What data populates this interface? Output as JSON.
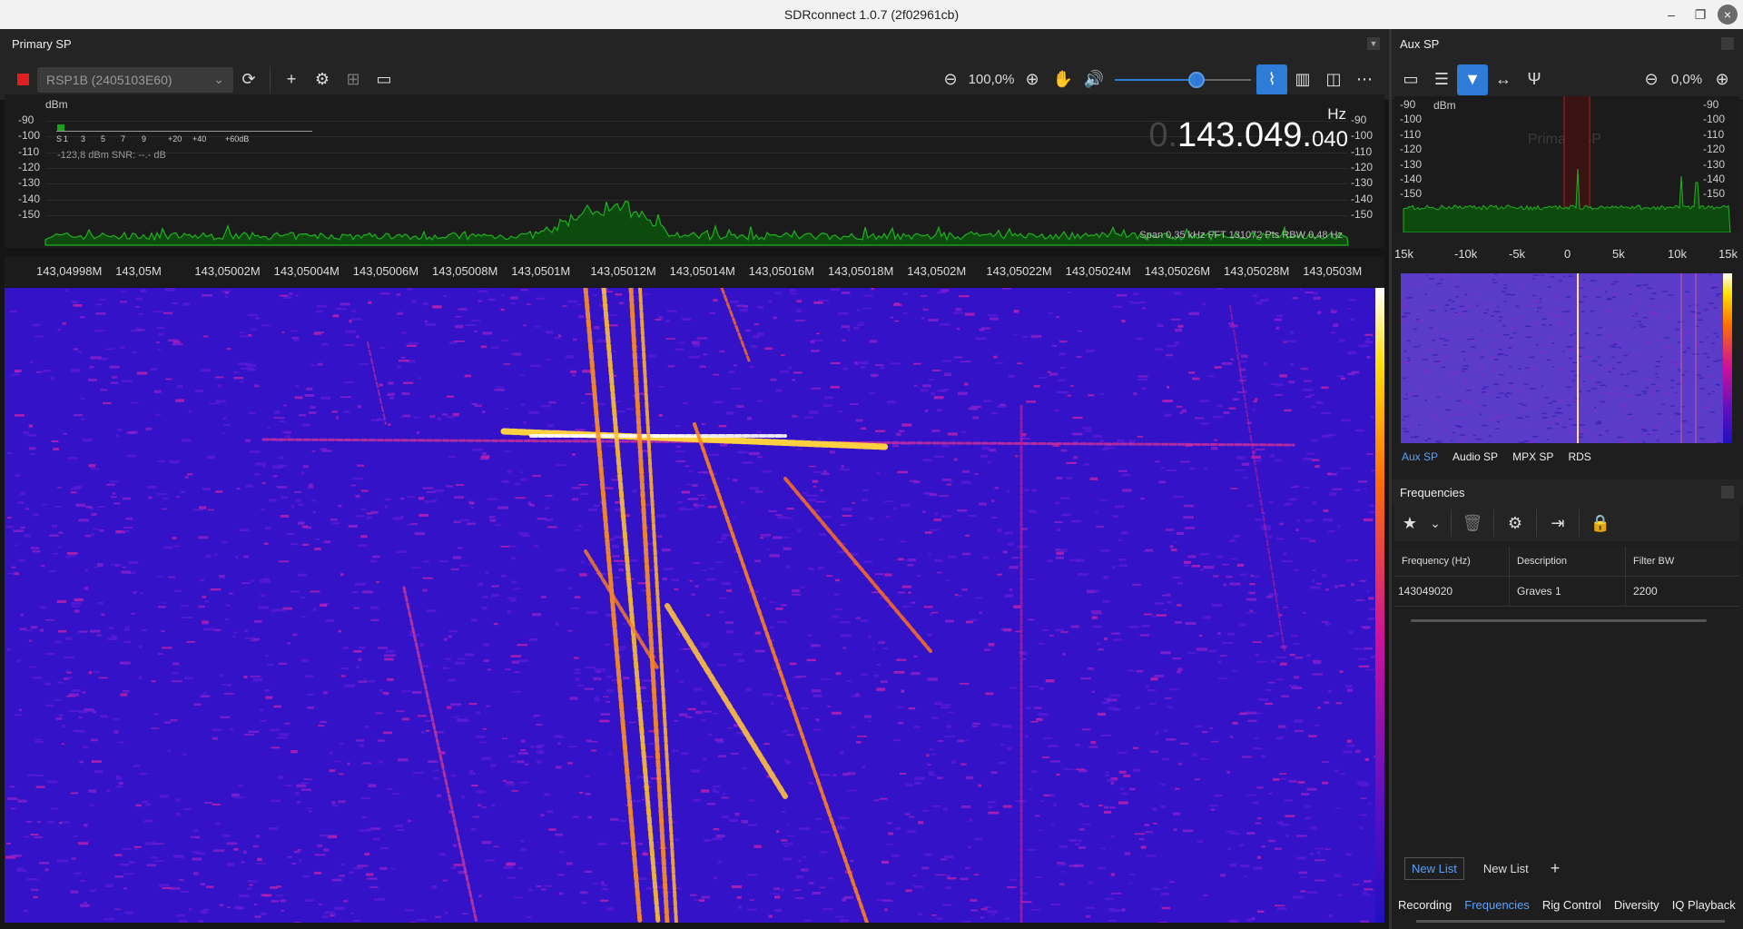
{
  "window": {
    "title": "SDRconnect 1.0.7 (2f02961cb)"
  },
  "primary": {
    "header": "Primary SP",
    "device": "RSP1B (2405103E60)",
    "zoom": "100,0%",
    "volume_level": 0.6,
    "freq_dim": "0.",
    "freq_main": "143.049.",
    "freq_small": "040",
    "freq_unit": "Hz",
    "dbm_label": "dBm",
    "db_left": [
      "-90",
      "-100",
      "-110",
      "-120",
      "-130",
      "-140",
      "-150"
    ],
    "db_right": [
      "-90",
      "-100",
      "-110",
      "-120",
      "-130",
      "-140",
      "-150"
    ],
    "smeter_ticks": [
      "S",
      "1",
      "3",
      "5",
      "7",
      "9",
      "+20",
      "+40",
      "+60dB"
    ],
    "smeter_info": "-123,8 dBm  SNR:  --.- dB",
    "span_info": "Span 0,35 kHz FFT 131072 Pts  RBW 0,48 Hz",
    "freq_axis": [
      "143,04998M",
      "143,05M",
      "143,05002M",
      "143,05004M",
      "143,05006M",
      "143,05008M",
      "143,0501M",
      "143,05012M",
      "143,05014M",
      "143,05016M",
      "143,05018M",
      "143,0502M",
      "143,05022M",
      "143,05024M",
      "143,05026M",
      "143,05028M",
      "143,0503M"
    ]
  },
  "aux": {
    "header": "Aux SP",
    "zoom": "0,0%",
    "dbm_label": "dBm",
    "watermark": "Primary SP",
    "db_left": [
      "-90",
      "-100",
      "-110",
      "-120",
      "-130",
      "-140",
      "-150"
    ],
    "db_right": [
      "-90",
      "-100",
      "-110",
      "-120",
      "-130",
      "-140",
      "-150"
    ],
    "axis": [
      "15k",
      "-10k",
      "-5k",
      "0",
      "5k",
      "10k",
      "15k"
    ],
    "tabs": [
      "Aux SP",
      "Audio SP",
      "MPX SP",
      "RDS"
    ]
  },
  "frequencies": {
    "header": "Frequencies",
    "columns": [
      "Frequency (Hz)",
      "Description",
      "Filter BW"
    ],
    "rows": [
      {
        "freq": "143049020",
        "desc": "Graves 1",
        "bw": "2200"
      }
    ],
    "lists": [
      "New List",
      "New List"
    ],
    "add": "+"
  },
  "bottom_tabs": [
    "Recording",
    "Frequencies",
    "Rig Control",
    "Diversity",
    "IQ Playback"
  ],
  "colors": {
    "accent": "#2f7bd8",
    "record": "#e02020",
    "spectrum": "#1aa31a"
  }
}
